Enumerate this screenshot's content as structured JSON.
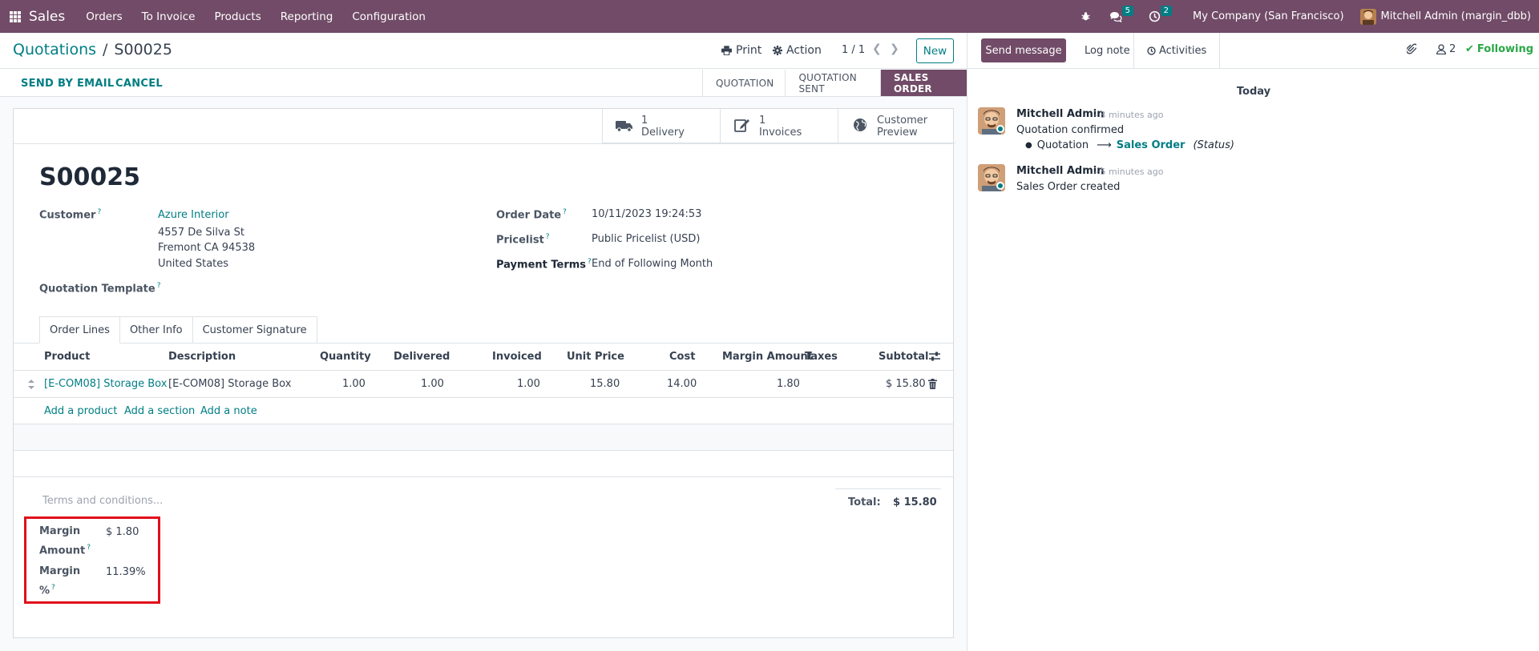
{
  "navbar": {
    "app_name": "Sales",
    "menu": [
      "Orders",
      "To Invoice",
      "Products",
      "Reporting",
      "Configuration"
    ],
    "messages_badge": "5",
    "activities_badge": "2",
    "company": "My Company (San Francisco)",
    "user": "Mitchell Admin (margin_dbb)"
  },
  "control": {
    "breadcrumb_parent": "Quotations",
    "breadcrumb_sep": "/",
    "breadcrumb_current": "S00025",
    "print_label": "Print",
    "action_label": "Action",
    "pager": "1 / 1",
    "new_label": "New",
    "send_email_label": "SEND BY EMAIL",
    "cancel_label": "CANCEL",
    "statuses": [
      "QUOTATION",
      "QUOTATION SENT",
      "SALES ORDER"
    ]
  },
  "smart_buttons": {
    "delivery_count": "1",
    "delivery_label": "Delivery",
    "invoices_count": "1",
    "invoices_label": "Invoices",
    "preview_line1": "Customer",
    "preview_line2": "Preview"
  },
  "form": {
    "title": "S00025",
    "customer_label": "Customer",
    "customer_name": "Azure Interior",
    "customer_addr1": "4557 De Silva St",
    "customer_addr2": "Fremont CA 94538",
    "customer_addr3": "United States",
    "template_label": "Quotation Template",
    "order_date_label": "Order Date",
    "order_date": "10/11/2023 19:24:53",
    "pricelist_label": "Pricelist",
    "pricelist": "Public Pricelist (USD)",
    "payment_terms_label": "Payment Terms",
    "payment_terms": "End of Following Month",
    "tabs": [
      "Order Lines",
      "Other Info",
      "Customer Signature"
    ],
    "columns": [
      "Product",
      "Description",
      "Quantity",
      "Delivered",
      "Invoiced",
      "Unit Price",
      "Cost",
      "Margin Amount",
      "Taxes",
      "Subtotal"
    ],
    "line": {
      "product": "[E-COM08] Storage Box",
      "description": "[E-COM08] Storage Box",
      "quantity": "1.00",
      "delivered": "1.00",
      "invoiced": "1.00",
      "unit_price": "15.80",
      "cost": "14.00",
      "margin_amount": "1.80",
      "taxes": "",
      "subtotal": "$ 15.80"
    },
    "add_product": "Add a product",
    "add_section": "Add a section",
    "add_note": "Add a note",
    "terms_placeholder": "Terms and conditions...",
    "total_label": "Total:",
    "total_value": "$ 15.80",
    "margin_amount_label_1": "Margin",
    "margin_amount_label_2": "Amount",
    "margin_amount_value": "$ 1.80",
    "margin_pct_label_1": "Margin",
    "margin_pct_label_2": "%",
    "margin_pct_value": "11.39%"
  },
  "chatter": {
    "send_message": "Send message",
    "log_note": "Log note",
    "activities": "Activities",
    "followers_count": "2",
    "following": "Following",
    "today": "Today",
    "messages": [
      {
        "author": "Mitchell Admin",
        "time": "- 3 minutes ago",
        "body": "Quotation confirmed",
        "change_from": "Quotation",
        "change_to": "Sales Order",
        "change_field": "(Status)"
      },
      {
        "author": "Mitchell Admin",
        "time": "- 5 minutes ago",
        "body": "Sales Order created"
      }
    ]
  }
}
